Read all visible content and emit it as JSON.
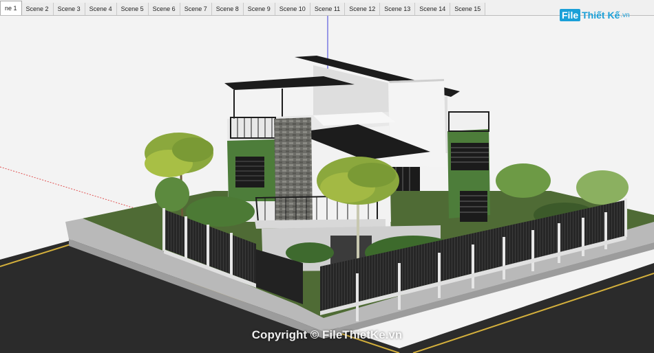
{
  "scene_tabs": [
    "ne 1",
    "Scene 2",
    "Scene 3",
    "Scene 4",
    "Scene 5",
    "Scene 6",
    "Scene 7",
    "Scene 8",
    "Scene 9",
    "Scene 10",
    "Scene 11",
    "Scene 12",
    "Scene 13",
    "Scene 14",
    "Scene 15"
  ],
  "active_tab_index": 0,
  "logo": {
    "box_text": "File",
    "rest_text": "Thiết Kế",
    "ext_text": ".vn"
  },
  "watermark": "Copyright © FileThietKe.vn",
  "colors": {
    "sky": "#f3f3f3",
    "grass": "#4f6b35",
    "road": "#2b2b2b",
    "sidewalk": "#b9b9b9",
    "wall_green": "#4d7d3a",
    "roof": "#1c1c1c",
    "fence": "#2a2a2a"
  }
}
